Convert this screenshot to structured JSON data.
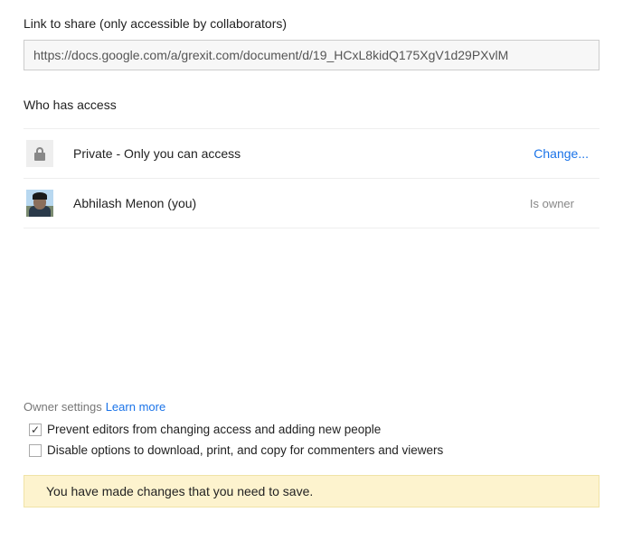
{
  "link": {
    "label": "Link to share (only accessible by collaborators)",
    "url": "https://docs.google.com/a/grexit.com/document/d/19_HCxL8kidQ175XgV1d29PXvlM"
  },
  "access": {
    "heading": "Who has access",
    "privacy_text": "Private - Only you can access",
    "change_label": "Change...",
    "user_name": "Abhilash Menon (you)",
    "role": "Is owner"
  },
  "settings": {
    "heading": "Owner settings",
    "learn_more": "Learn more",
    "opt1_label": "Prevent editors from changing access and adding new people",
    "opt1_check": "✓",
    "opt2_label": "Disable options to download, print, and copy for commenters and viewers",
    "opt2_check": ""
  },
  "notice": "You have made changes that you need to save."
}
